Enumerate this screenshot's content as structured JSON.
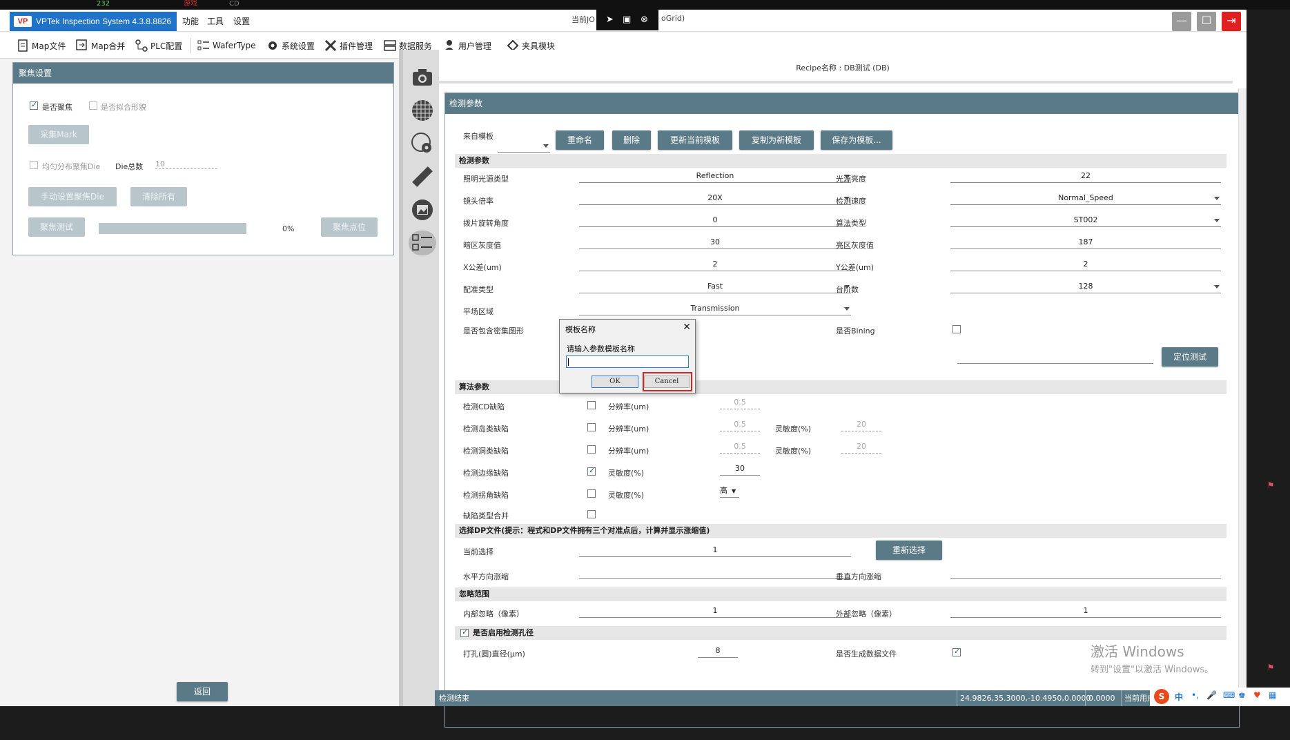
{
  "browser": {
    "tab1": "232",
    "tab2": "游戏",
    "tab3": "CD"
  },
  "app": {
    "title": "VPTek Inspection System 4.3.8.8826",
    "logo": "VP",
    "menus": [
      "功能",
      "工具",
      "设置"
    ],
    "center_title_prefix": "当前JO",
    "center_title_suffix": "oGrid)"
  },
  "toolbar": {
    "items": [
      "Map文件",
      "Map合并",
      "PLC配置",
      "WaferType",
      "系统设置",
      "插件管理",
      "数据服务",
      "用户管理",
      "夹具模块"
    ]
  },
  "focus": {
    "header": "聚焦设置",
    "is_focus": "是否聚焦",
    "fit_shape": "是否拟合形貌",
    "collect_mark": "采集Mark",
    "uniform_die": "均匀分布聚焦Die",
    "die_total_label": "Die总数",
    "die_total_value": "10",
    "manual_die": "手动设置聚焦Die",
    "clear_all": "清除所有",
    "focus_test": "聚焦测试",
    "progress_text": "0%",
    "progress_value": 0,
    "focus_point": "聚焦点位",
    "back": "返回"
  },
  "recipe": {
    "name": "Recipe名称 : DB测试 (DB)",
    "header": "检测参数",
    "from_template": "来自模板",
    "buttons": {
      "rename": "重命名",
      "delete": "删除",
      "update": "更新当前模板",
      "copy": "复制为新模板",
      "save": "保存为模板..."
    },
    "section_detect": "检测参数",
    "fields": {
      "light_type_label": "照明光源类型",
      "light_type": "Reflection",
      "light_bright_label": "光源亮度",
      "light_bright": "22",
      "lens_label": "镜头倍率",
      "lens": "20X",
      "speed_label": "检测速度",
      "speed": "Normal_Speed",
      "rotate_label": "拨片旋转角度",
      "rotate": "0",
      "algo_label": "算法类型",
      "algo": "ST002",
      "dark_label": "暗区灰度值",
      "dark": "30",
      "bright_label": "亮区灰度值",
      "bright": "187",
      "xtol_label": "X公差(um)",
      "xtol": "2",
      "ytol_label": "Y公差(um)",
      "ytol": "2",
      "align_label": "配准类型",
      "align": "Fast",
      "steps_label": "台阶数",
      "steps": "128",
      "flat_label": "平场区域",
      "flat": "Transmission",
      "dense_label": "是否包含密集图形",
      "bining_label": "是否Bining",
      "locate_test": "定位测试"
    },
    "section_algo": "算法参数",
    "algo_rows": [
      {
        "label": "检测CD缺陷",
        "p1": "分辨率(um)",
        "v1": "0.5"
      },
      {
        "label": "检测岛类缺陷",
        "p1": "分辨率(um)",
        "v1": "0.5",
        "p2": "灵敏度(%)",
        "v2": "20"
      },
      {
        "label": "检测洞类缺陷",
        "p1": "分辨率(um)",
        "v1": "0.5",
        "p2": "灵敏度(%)",
        "v2": "20"
      },
      {
        "label": "检测边缘缺陷",
        "p1": "灵敏度(%)",
        "v1": "30"
      },
      {
        "label": "检测拐角缺陷",
        "p1": "灵敏度(%)",
        "v1": "高"
      },
      {
        "label": "缺陷类型合并"
      }
    ],
    "section_dp": "选择DP文件(提示：程式和DP文件拥有三个对准点后，计算并显示涨缩值)",
    "dp_current_label": "当前选择",
    "dp_current": "1",
    "dp_reselect": "重新选择",
    "dp_h_label": "水平方向涨缩",
    "dp_v_label": "垂直方向涨缩",
    "section_ignore": "忽略范围",
    "inner_label": "内部忽略（像素）",
    "inner": "1",
    "outer_label": "外部忽略（像素）",
    "outer": "1",
    "section_hole": "是否启用检测孔径",
    "hole_label": "打孔(圆)直径(μm)",
    "hole": "8",
    "gen_data_label": "是否生成数据文件"
  },
  "dialog": {
    "title": "模板名称",
    "prompt": "请输入参数模板名称",
    "input_value": "",
    "ok": "OK",
    "cancel": "Cancel"
  },
  "status": {
    "left": "检测结束",
    "coords": "24.9826,35.3000,-10.4950,0.0000",
    "value": "0.0000",
    "user": "当前用户"
  },
  "watermark": {
    "line1": "激活 Windows",
    "line2": "转到\"设置\"以激活 Windows。"
  },
  "taskbar": {
    "ime": "中"
  },
  "colors": {
    "accent": "#5a7a87",
    "title_blue": "#1f73c9",
    "highlight_red": "#e02020"
  }
}
